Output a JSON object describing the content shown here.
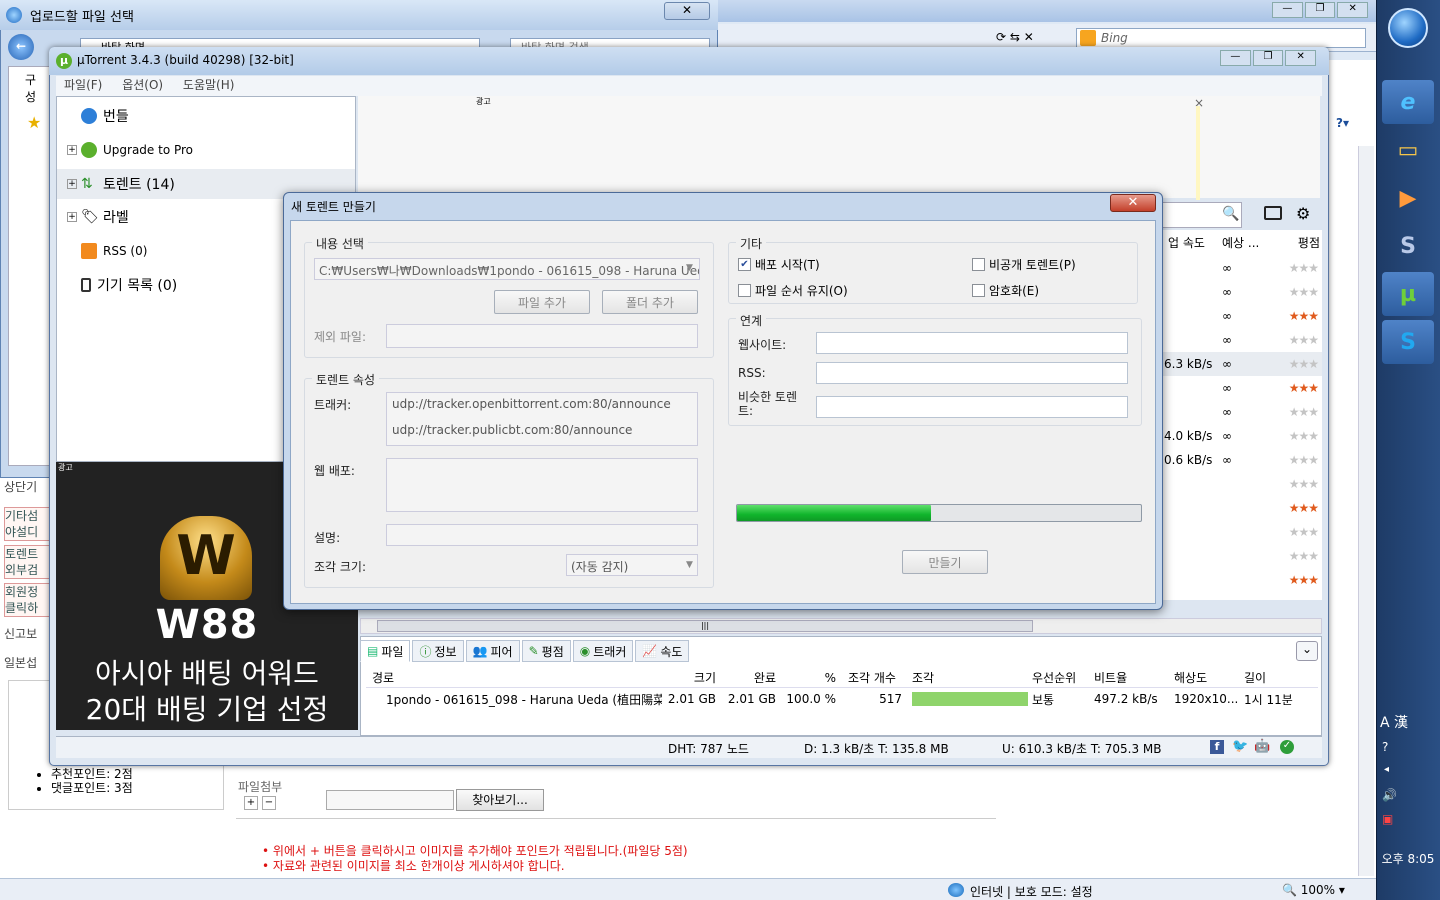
{
  "upload_window": {
    "title": "업로드할 파일 선택",
    "nav_path": "바탕 화면",
    "search_placeholder": "바탕 화면 검색",
    "side_label": "구성"
  },
  "ie": {
    "search_placeholder": "Bing",
    "status_zone": "인터넷 | 보호 모드: 설정",
    "zoom": "100%"
  },
  "webpage": {
    "left_labels": [
      "상단기",
      "기타섬",
      "야설디",
      "토렌트",
      "외부검",
      "회원정",
      "클릭하",
      "신고보",
      "일본섭"
    ],
    "points": [
      "추천포인트: 2점",
      "댓글포인트: 3점"
    ],
    "attach_label": "파일첨부",
    "browse_button": "찾아보기...",
    "notes": [
      "위에서 + 버튼을 클릭하시고 이미지를 추가해야 포인트가 적립됩니다.(파일당 5점)",
      "자료와 관련된 이미지를 최소 한개이상 게시하셔야 합니다."
    ]
  },
  "utorrent": {
    "title": "µTorrent 3.4.3  (build 40298) [32-bit]",
    "menu": [
      "파일(F)",
      "옵션(O)",
      "도움말(H)"
    ],
    "ad_label": "광고",
    "sidebar": [
      {
        "label": "번들"
      },
      {
        "label": "Upgrade to Pro"
      },
      {
        "label": "토렌트 (14)"
      },
      {
        "label": "라벨"
      },
      {
        "label": "RSS (0)"
      },
      {
        "label": "기기 목록 (0)"
      }
    ],
    "grid_headers": {
      "upload": "업 속도",
      "eta": "예상 ...",
      "rating": "평점"
    },
    "grid_rows": [
      {
        "up": "",
        "eta": "∞",
        "stars": 0
      },
      {
        "up": "",
        "eta": "∞",
        "stars": 0
      },
      {
        "up": "",
        "eta": "∞",
        "stars": 3
      },
      {
        "up": "",
        "eta": "∞",
        "stars": 0
      },
      {
        "up": "6.3 kB/s",
        "eta": "∞",
        "stars": 0
      },
      {
        "up": "",
        "eta": "∞",
        "stars": 3
      },
      {
        "up": "",
        "eta": "∞",
        "stars": 0
      },
      {
        "up": "4.0 kB/s",
        "eta": "∞",
        "stars": 0
      },
      {
        "up": "0.6 kB/s",
        "eta": "∞",
        "stars": 0
      },
      {
        "up": "",
        "eta": "",
        "stars": 0
      },
      {
        "up": "",
        "eta": "",
        "stars": 3
      },
      {
        "up": "",
        "eta": "",
        "stars": 0
      },
      {
        "up": "",
        "eta": "",
        "stars": 0
      },
      {
        "up": "",
        "eta": "",
        "stars": 3
      }
    ],
    "ad_banner": {
      "brand": "W88",
      "line1": "아시아 배팅 어워드",
      "line2": "20대 배팅 기업 선정"
    },
    "tabs": [
      "파일",
      "정보",
      "피어",
      "평점",
      "트래커",
      "속도"
    ],
    "files_headers": [
      "경로",
      "크기",
      "완료",
      "%",
      "조각 개수",
      "조각",
      "우선순위",
      "비트율",
      "해상도",
      "길이"
    ],
    "files_row": {
      "path": "1pondo - 061615_098 - Haruna Ueda (植田陽菜)...",
      "size": "2.01 GB",
      "done": "2.01 GB",
      "pct": "100.0 %",
      "pieces": "517",
      "priority": "보통",
      "bitrate": "497.2 kB/s",
      "resolution": "1920x10...",
      "length": "1시 11분"
    },
    "status": {
      "dht": "DHT: 787 노드",
      "down": "D: 1.3 kB/초 T: 135.8 MB",
      "up": "U: 610.3 kB/초 T: 705.3 MB"
    }
  },
  "dialog": {
    "title": "새 토렌트 만들기",
    "content_group": "내용 선택",
    "source_path": "C:₩Users₩나₩Downloads₩1pondo - 061615_098 - Haruna Ueda (",
    "add_file": "파일 추가",
    "add_folder": "폴더 추가",
    "skip_files": "제외 파일:",
    "props_group": "토렌트 속성",
    "trackers_label": "트래커:",
    "trackers": [
      "udp://tracker.openbittorrent.com:80/announce",
      "udp://tracker.publicbt.com:80/announce"
    ],
    "webseeds_label": "웹 배포:",
    "comment_label": "설명:",
    "piece_label": "조각 크기:",
    "piece_value": "(자동 감지)",
    "other_group": "기타",
    "cb_start_seed": "배포 시작(T)",
    "cb_private": "비공개 토렌트(P)",
    "cb_preserve_order": "파일 순서 유지(O)",
    "cb_encrypt": "암호화(E)",
    "link_group": "연계",
    "website_label": "웹사이트:",
    "rss_label": "RSS:",
    "similar_label": "비슷한 토렌트:",
    "progress": 0.48,
    "create_button": "만들기"
  },
  "taskbar": {
    "clock": "오후 8:05",
    "ime": "A 漢"
  }
}
